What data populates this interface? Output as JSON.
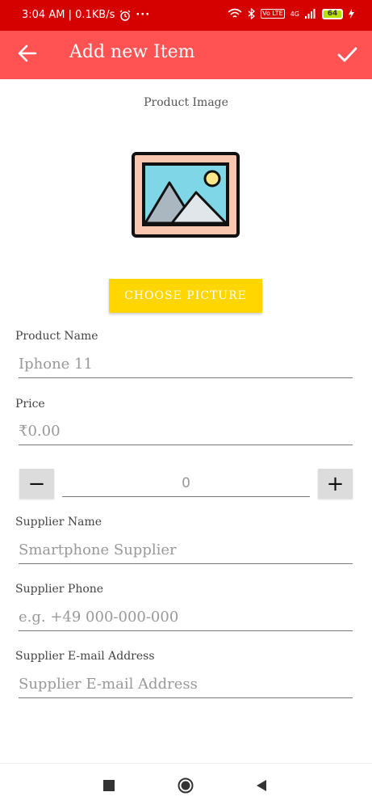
{
  "status_bar": {
    "time_info": "3:04 AM | 0.1KB/s",
    "more": "···",
    "network": "4G",
    "lte": "Vo LTE",
    "battery": "64"
  },
  "app_bar": {
    "title": "Add new Item"
  },
  "product_image": {
    "label": "Product Image"
  },
  "choose_button": {
    "label": "CHOOSE PICTURE"
  },
  "fields": {
    "product_name": {
      "label": "Product Name",
      "placeholder": "Iphone 11"
    },
    "price": {
      "label": "Price",
      "placeholder": "₹0.00"
    },
    "quantity": {
      "value": "0",
      "minus": "−",
      "plus": "+"
    },
    "supplier_name": {
      "label": "Supplier Name",
      "placeholder": "Smartphone Supplier"
    },
    "supplier_phone": {
      "label": "Supplier Phone",
      "placeholder": "e.g. +49 000-000-000"
    },
    "supplier_email": {
      "label": "Supplier E-mail Address",
      "placeholder": "Supplier E-mail Address"
    }
  },
  "colors": {
    "status_bar": "#d50000",
    "app_bar": "#ff5252",
    "accent_button": "#ffd600"
  },
  "icons": [
    "back-arrow-icon",
    "check-icon",
    "image-placeholder-icon",
    "alarm-icon",
    "wifi-icon",
    "bluetooth-icon",
    "signal-icon",
    "battery-icon",
    "charging-icon",
    "recents-icon",
    "home-icon",
    "back-triangle-icon"
  ]
}
